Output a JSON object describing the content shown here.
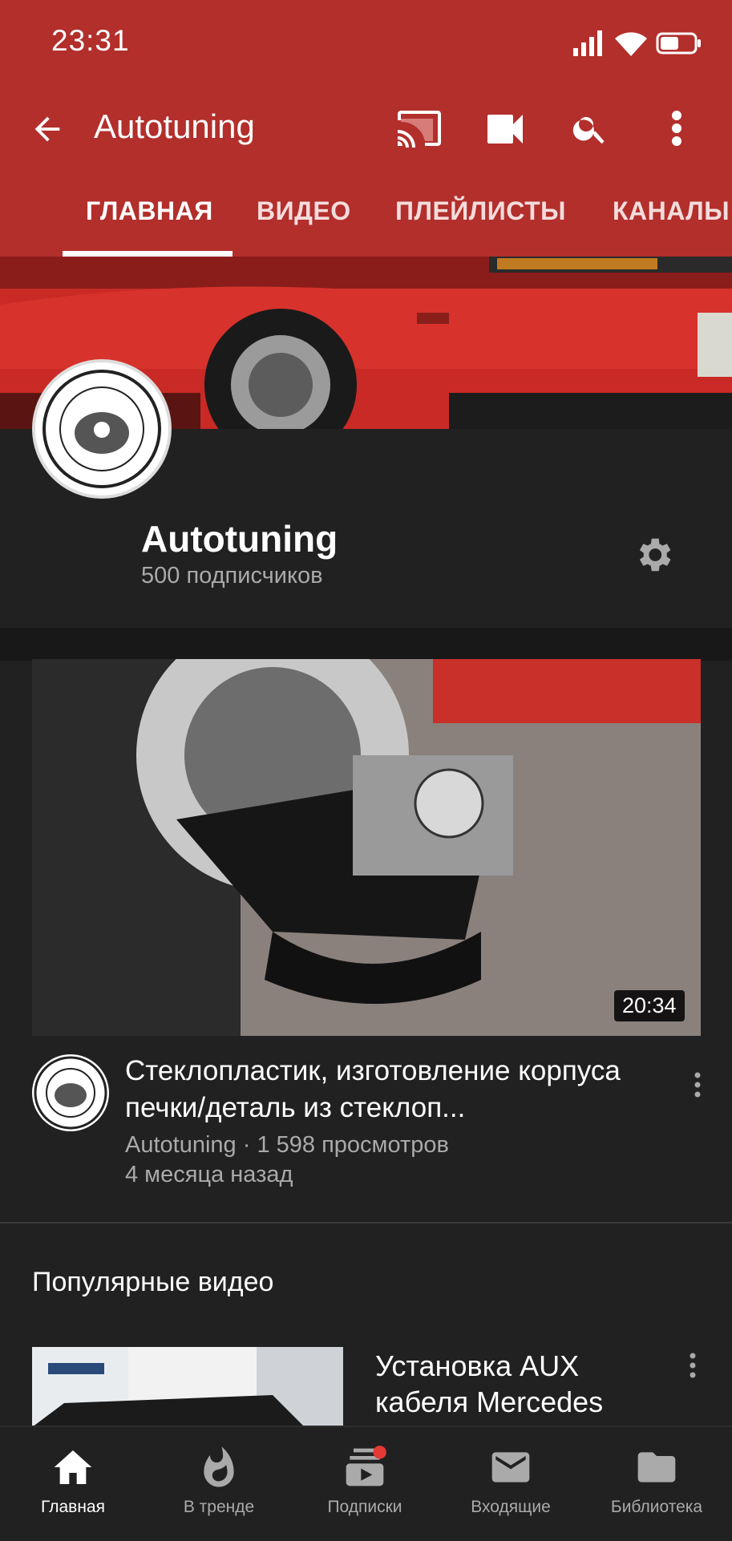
{
  "status": {
    "time": "23:31"
  },
  "appbar": {
    "title": "Autotuning"
  },
  "tabs": [
    "ГЛАВНАЯ",
    "ВИДЕО",
    "ПЛЕЙЛИСТЫ",
    "КАНАЛЫ"
  ],
  "channel": {
    "name": "Autotuning",
    "subscribers": "500 подписчиков"
  },
  "featured_video": {
    "title": "Стеклопластик, изготовление корпуса печки/деталь из стеклоп...",
    "channel_views": "Autotuning · 1 598 просмотров",
    "age": "4 месяца назад",
    "duration": "20:34"
  },
  "section": {
    "title": "Популярные видео"
  },
  "popular_video": {
    "title": "Установка AUX кабеля Mercedes"
  },
  "bottom_nav": [
    "Главная",
    "В тренде",
    "Подписки",
    "Входящие",
    "Библиотека"
  ],
  "colors": {
    "brand": "#b22f2c",
    "background": "#212121",
    "notification": "#e53935"
  },
  "icons": [
    "back-arrow-icon",
    "cast-icon",
    "video-camera-icon",
    "search-icon",
    "more-vert-icon",
    "gear-icon",
    "home-icon",
    "fire-icon",
    "subscriptions-icon",
    "inbox-icon",
    "library-icon"
  ]
}
